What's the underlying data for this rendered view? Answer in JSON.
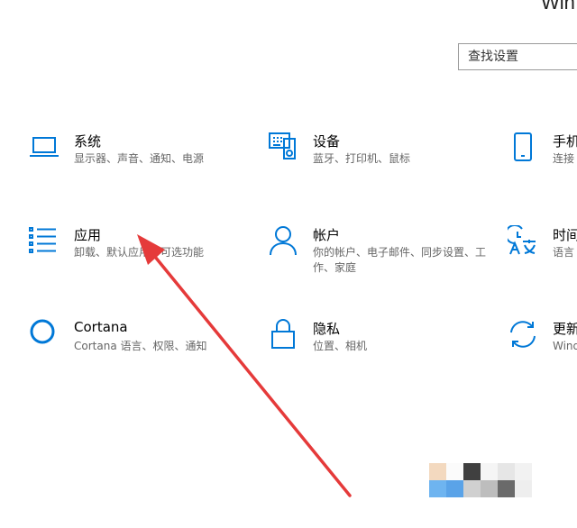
{
  "window": {
    "title": "Win"
  },
  "search": {
    "placeholder": "查找设置"
  },
  "tiles": [
    {
      "title": "系统",
      "desc": "显示器、声音、通知、电源",
      "icon": "laptop-icon"
    },
    {
      "title": "设备",
      "desc": "蓝牙、打印机、鼠标",
      "icon": "keyboard-device-icon"
    },
    {
      "title": "手机",
      "desc": "连接",
      "icon": "phone-icon"
    },
    {
      "title": "应用",
      "desc": "卸载、默认应用、可选功能",
      "icon": "apps-list-icon"
    },
    {
      "title": "帐户",
      "desc": "你的帐户、电子邮件、同步设置、工作、家庭",
      "icon": "person-icon"
    },
    {
      "title": "时间",
      "desc": "语言",
      "icon": "time-language-icon"
    },
    {
      "title": "Cortana",
      "desc": "Cortana 语言、权限、通知",
      "icon": "cortana-circle-icon"
    },
    {
      "title": "隐私",
      "desc": "位置、相机",
      "icon": "lock-icon"
    },
    {
      "title": "更新",
      "desc": "Windo",
      "icon": "update-sync-icon"
    }
  ],
  "colors": {
    "accent": "#0078d7",
    "arrow": "#e53a3a",
    "text_primary": "#000000",
    "text_secondary": "#666666"
  }
}
